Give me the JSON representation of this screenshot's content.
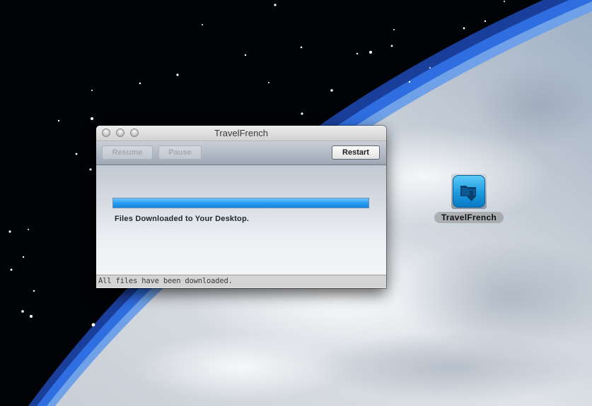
{
  "window": {
    "title": "TravelFrench",
    "toolbar": {
      "resume_label": "Resume",
      "pause_label": "Pause",
      "restart_label": "Restart"
    },
    "progress": {
      "value_percent": 100
    },
    "message": "Files Downloaded to Your Desktop.",
    "status": "All files have been downloaded."
  },
  "desktop_icon": {
    "label": "TravelFrench",
    "icon": "folder-download-icon"
  },
  "colors": {
    "progress_fill": "#1e94ec",
    "icon_accent": "#1b9ae0"
  }
}
